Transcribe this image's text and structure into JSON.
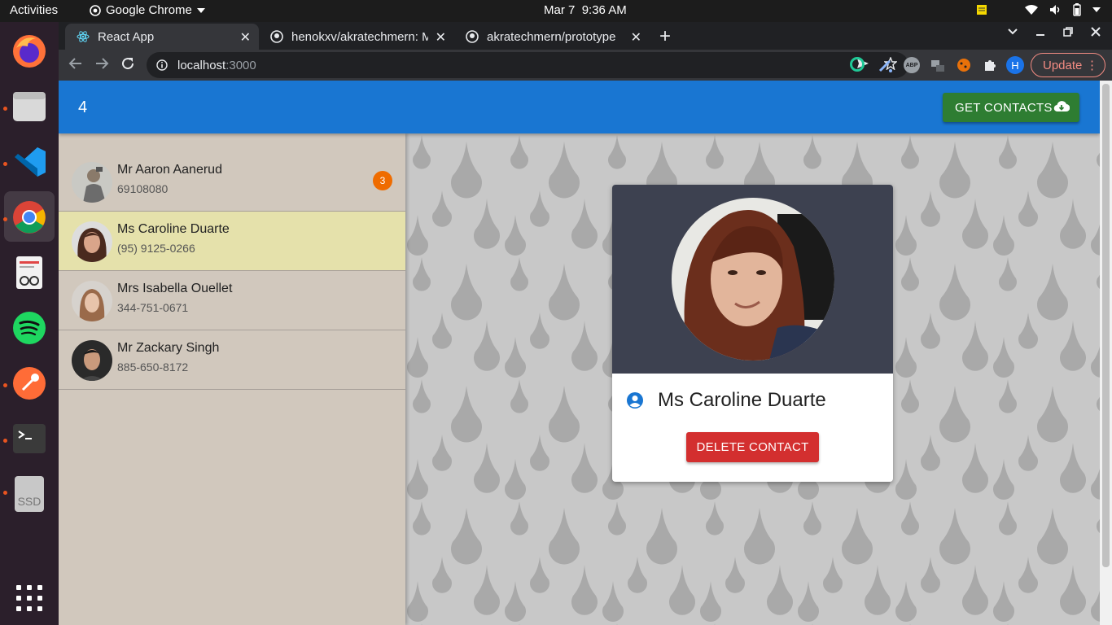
{
  "system": {
    "activities": "Activities",
    "app_menu": "Google Chrome",
    "date": "Mar 7",
    "time": "9:36 AM"
  },
  "dock": {
    "items": [
      "firefox-icon",
      "files-icon",
      "vscode-icon",
      "chrome-icon",
      "document-viewer-icon",
      "spotify-icon",
      "postman-icon",
      "terminal-icon",
      "ssd-drive-icon",
      "app-grid-icon"
    ],
    "ssd_label": "SSD"
  },
  "browser": {
    "tabs": [
      {
        "title": "React App",
        "active": true
      },
      {
        "title": "henokxv/akratechmern: M",
        "active": false
      },
      {
        "title": "akratechmern/prototype",
        "active": false
      }
    ],
    "url_host": "localhost",
    "url_port": ":3000",
    "profile_initial": "H",
    "update_label": "Update"
  },
  "app": {
    "count": "4",
    "get_contacts_label": "GET CONTACTS",
    "contacts": [
      {
        "name": "Mr Aaron Aanerud",
        "phone": "69108080",
        "badge": "3",
        "selected": false
      },
      {
        "name": "Ms Caroline Duarte",
        "phone": "(95) 9125-0266",
        "badge": "",
        "selected": true
      },
      {
        "name": "Mrs Isabella Ouellet",
        "phone": "344-751-0671",
        "badge": "",
        "selected": false
      },
      {
        "name": "Mr Zackary Singh",
        "phone": "885-650-8172",
        "badge": "",
        "selected": false
      }
    ],
    "detail": {
      "name": "Ms Caroline Duarte",
      "delete_label": "DELETE CONTACT"
    }
  },
  "colors": {
    "appbar": "#1976d2",
    "get_button": "#2e7d32",
    "delete_button": "#d32f2f",
    "sidebar": "#d1c8bd",
    "selected_row": "#e5e1ab",
    "badge": "#ef6c00"
  }
}
